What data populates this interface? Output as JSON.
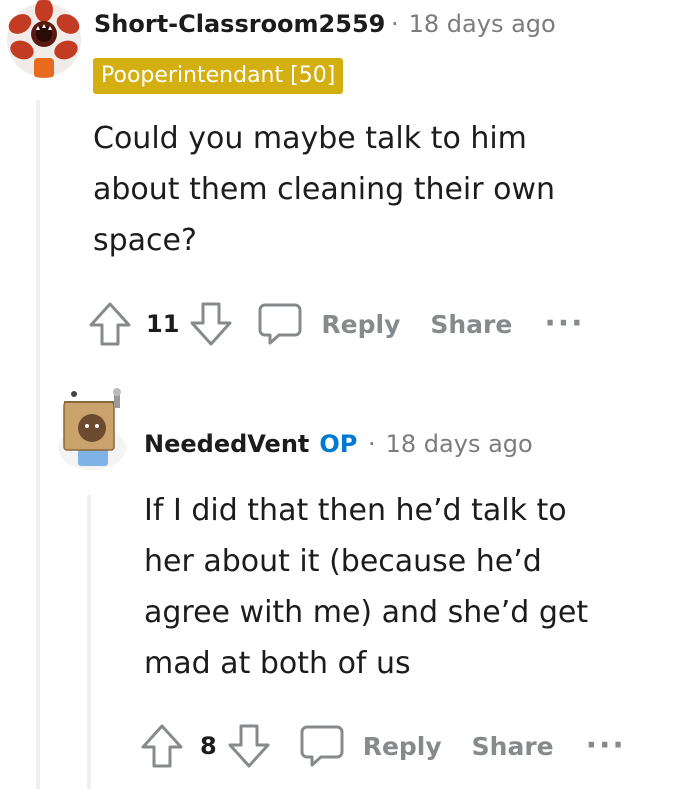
{
  "comments": [
    {
      "username": "Short-Classroom2559",
      "separator": "·",
      "time": "18 days ago",
      "flair": "Pooperintendant [50]",
      "body": "Could you maybe talk to him about them cleaning their own space?",
      "votes": "11",
      "reply_label": "Reply",
      "share_label": "Share",
      "more_label": "···"
    },
    {
      "username": "NeededVent",
      "op_badge": "OP",
      "separator": "·",
      "time": "18 days ago",
      "body": "If I did that then he’d talk to her about it (because he’d agree with me) and she’d get mad at both of us",
      "votes": "8",
      "reply_label": "Reply",
      "share_label": "Share",
      "more_label": "···"
    }
  ],
  "icons": {
    "upvote": "arrow-up-icon",
    "downvote": "arrow-down-icon",
    "comment": "speech-bubble-icon",
    "more": "ellipsis-icon"
  },
  "colors": {
    "flair_bg": "#d4af12",
    "op": "#0079d3",
    "muted": "#878a8c",
    "thread_line": "#edeff1"
  }
}
